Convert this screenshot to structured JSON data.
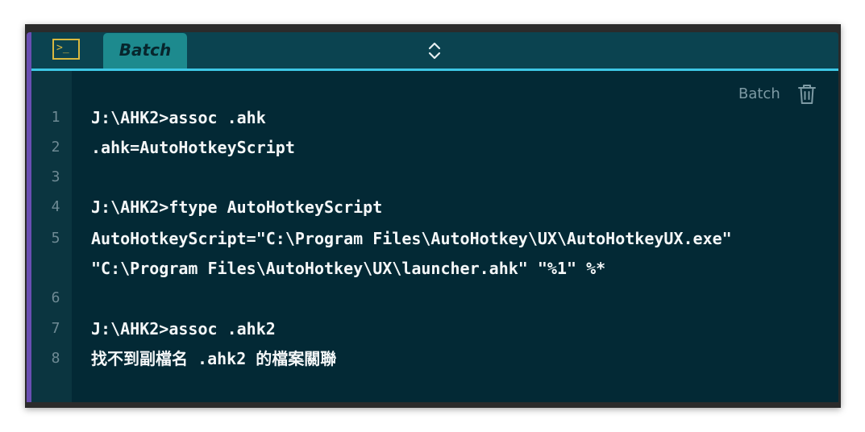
{
  "tab": {
    "label": "Batch",
    "icon": "terminal-icon"
  },
  "toolbar": {
    "language_label": "Batch",
    "trash_icon": "trash-icon",
    "switcher_icon": "chevron-up-down-icon"
  },
  "colors": {
    "accent_bar": "#6a4fb3",
    "accent_line": "#3ec8e6",
    "tab_bg": "#1d8a8e",
    "icon_yellow": "#d8b840",
    "code_bg": "#032935"
  },
  "lines": [
    {
      "num": "1",
      "text": "J:\\AHK2>assoc .ahk"
    },
    {
      "num": "2",
      "text": ".ahk=AutoHotkeyScript"
    },
    {
      "num": "3",
      "text": ""
    },
    {
      "num": "4",
      "text": "J:\\AHK2>ftype AutoHotkeyScript"
    },
    {
      "num": "5",
      "text": "AutoHotkeyScript=\"C:\\Program Files\\AutoHotkey\\UX\\AutoHotkeyUX.exe\""
    },
    {
      "num": "",
      "text": "\"C:\\Program Files\\AutoHotkey\\UX\\launcher.ahk\" \"%1\" %*"
    },
    {
      "num": "6",
      "text": ""
    },
    {
      "num": "7",
      "text": "J:\\AHK2>assoc .ahk2"
    },
    {
      "num": "8",
      "text": "找不到副檔名 .ahk2 的檔案關聯"
    }
  ]
}
